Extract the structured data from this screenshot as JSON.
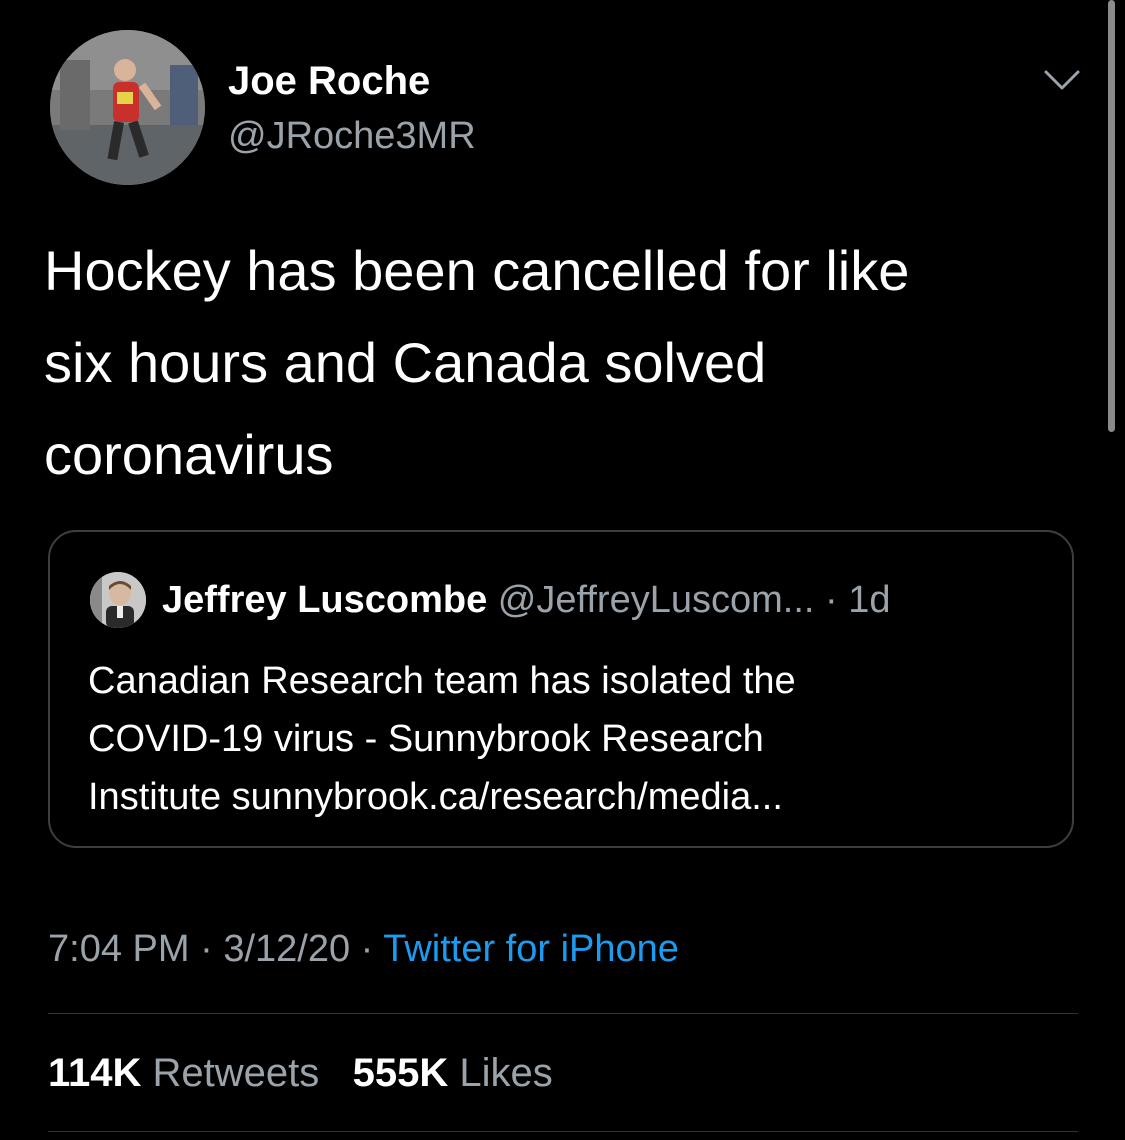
{
  "author": {
    "name": "Joe Roche",
    "handle": "@JRoche3MR"
  },
  "tweet": {
    "text": "Hockey has been cancelled for like\nsix hours and Canada solved\ncoronavirus"
  },
  "quoted_tweet": {
    "author_name": "Jeffrey Luscombe",
    "author_handle": "@JeffreyLuscom...",
    "time_ago": "· 1d",
    "text": "Canadian Research team has isolated the\nCOVID-19 virus - Sunnybrook Research\nInstitute sunnybrook.ca/research/media..."
  },
  "meta": {
    "time": "7:04 PM",
    "separator": " · ",
    "date": "3/12/20",
    "source": "Twitter for iPhone"
  },
  "stats": {
    "retweets_count": "114K",
    "retweets_label": "Retweets",
    "likes_count": "555K",
    "likes_label": "Likes"
  },
  "icons": {
    "menu": "chevron-down-icon"
  },
  "colors": {
    "background": "#000000",
    "text": "#ffffff",
    "secondary_text": "#9aa2aa",
    "link": "#1d9bf0",
    "border": "#3a3f44"
  }
}
